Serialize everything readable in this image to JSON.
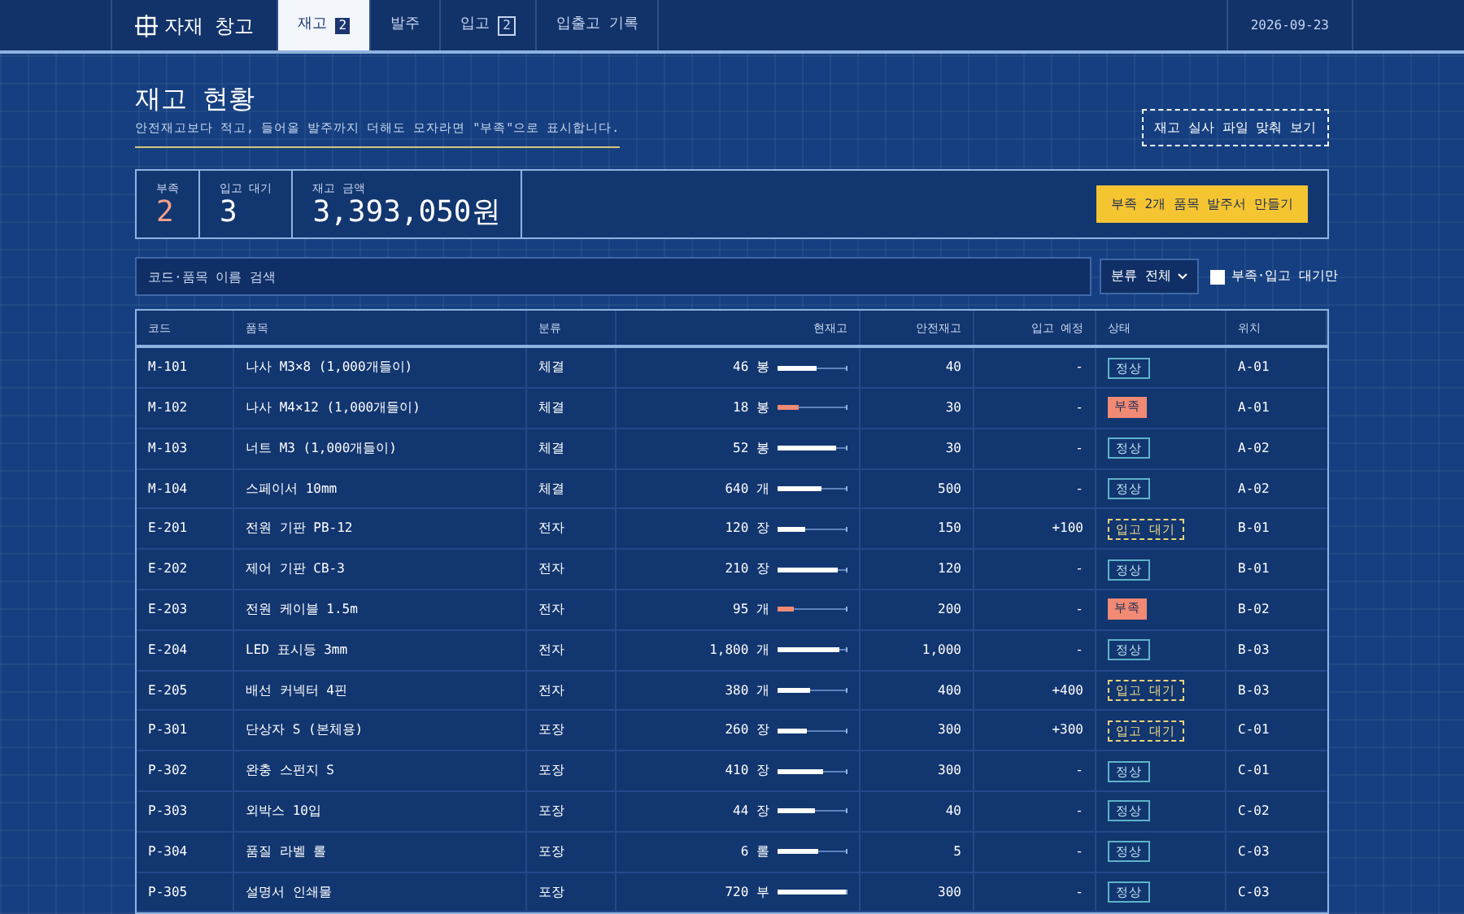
{
  "app": {
    "title": "자재 창고",
    "date": "2026-09-23"
  },
  "tabs": [
    {
      "label": "재고",
      "badge": "2",
      "selected": true
    },
    {
      "label": "발주",
      "selected": false
    },
    {
      "label": "입고",
      "badge": "2",
      "selected": false
    },
    {
      "label": "입출고 기록",
      "selected": false
    }
  ],
  "page": {
    "title": "재고 현황",
    "subtitle": "안전재고보다 적고, 들어올 발주까지 더해도 모자라면 \"부족\"으로 표시합니다.",
    "action": "재고 실사 파일 맞춰 보기"
  },
  "stats": [
    {
      "label": "부족",
      "value": "2",
      "kind": "alert"
    },
    {
      "label": "입고 대기",
      "value": "3",
      "kind": "plain"
    },
    {
      "label": "재고 금액",
      "value": "3,393,050원",
      "kind": "big"
    }
  ],
  "order_button": "부족 2개 품목 발주서 만들기",
  "filters": {
    "search": {
      "placeholder": "코드·품목 이름 검색"
    },
    "category": "분류 전체",
    "only_pending": {
      "label": "부족·입고 대기만",
      "checked": false
    }
  },
  "table": {
    "columns": [
      "코드",
      "품목",
      "분류",
      "현재고",
      "안전재고",
      "입고 예정",
      "상태",
      "위치"
    ],
    "rows": [
      {
        "code": "M-101",
        "name": "나사 M3×8 (1,000개들이)",
        "category": "체결",
        "stock": "46 봉",
        "level": 0.57,
        "safety": "40",
        "incoming": "-",
        "status": {
          "kind": "ok",
          "label": "정상"
        },
        "location": "A-01"
      },
      {
        "code": "M-102",
        "name": "나사 M4×12 (1,000개들이)",
        "category": "체결",
        "stock": "18 봉",
        "level": 0.3,
        "safety": "30",
        "incoming": "-",
        "status": {
          "kind": "short",
          "label": "부족"
        },
        "location": "A-01"
      },
      {
        "code": "M-103",
        "name": "너트 M3 (1,000개들이)",
        "category": "체결",
        "stock": "52 봉",
        "level": 0.86,
        "safety": "30",
        "incoming": "-",
        "status": {
          "kind": "ok",
          "label": "정상"
        },
        "location": "A-02"
      },
      {
        "code": "M-104",
        "name": "스페이서 10mm",
        "category": "체결",
        "stock": "640 개",
        "level": 0.64,
        "safety": "500",
        "incoming": "-",
        "status": {
          "kind": "ok",
          "label": "정상"
        },
        "location": "A-02"
      },
      {
        "code": "E-201",
        "name": "전원 기판 PB-12",
        "category": "전자",
        "stock": "120 장",
        "level": 0.4,
        "safety": "150",
        "incoming": "+100",
        "status": {
          "kind": "pending",
          "label": "입고 대기"
        },
        "location": "B-01"
      },
      {
        "code": "E-202",
        "name": "제어 기판 CB-3",
        "category": "전자",
        "stock": "210 장",
        "level": 0.88,
        "safety": "120",
        "incoming": "-",
        "status": {
          "kind": "ok",
          "label": "정상"
        },
        "location": "B-01"
      },
      {
        "code": "E-203",
        "name": "전원 케이블 1.5m",
        "category": "전자",
        "stock": "95 개",
        "level": 0.24,
        "safety": "200",
        "incoming": "-",
        "status": {
          "kind": "short",
          "label": "부족"
        },
        "location": "B-02"
      },
      {
        "code": "E-204",
        "name": "LED 표시등 3mm",
        "category": "전자",
        "stock": "1,800 개",
        "level": 0.9,
        "safety": "1,000",
        "incoming": "-",
        "status": {
          "kind": "ok",
          "label": "정상"
        },
        "location": "B-03"
      },
      {
        "code": "E-205",
        "name": "배선 커넥터 4핀",
        "category": "전자",
        "stock": "380 개",
        "level": 0.48,
        "safety": "400",
        "incoming": "+400",
        "status": {
          "kind": "pending",
          "label": "입고 대기"
        },
        "location": "B-03"
      },
      {
        "code": "P-301",
        "name": "단상자 S (본체용)",
        "category": "포장",
        "stock": "260 장",
        "level": 0.43,
        "safety": "300",
        "incoming": "+300",
        "status": {
          "kind": "pending",
          "label": "입고 대기"
        },
        "location": "C-01"
      },
      {
        "code": "P-302",
        "name": "완충 스펀지 S",
        "category": "포장",
        "stock": "410 장",
        "level": 0.67,
        "safety": "300",
        "incoming": "-",
        "status": {
          "kind": "ok",
          "label": "정상"
        },
        "location": "C-01"
      },
      {
        "code": "P-303",
        "name": "외박스 10입",
        "category": "포장",
        "stock": "44 장",
        "level": 0.55,
        "safety": "40",
        "incoming": "-",
        "status": {
          "kind": "ok",
          "label": "정상"
        },
        "location": "C-02"
      },
      {
        "code": "P-304",
        "name": "품질 라벨 롤",
        "category": "포장",
        "stock": "6 롤",
        "level": 0.6,
        "safety": "5",
        "incoming": "-",
        "status": {
          "kind": "ok",
          "label": "정상"
        },
        "location": "C-03"
      },
      {
        "code": "P-305",
        "name": "설명서 인쇄물",
        "category": "포장",
        "stock": "720 부",
        "level": 1.0,
        "safety": "300",
        "incoming": "-",
        "status": {
          "kind": "ok",
          "label": "정상"
        },
        "location": "C-03"
      }
    ]
  }
}
